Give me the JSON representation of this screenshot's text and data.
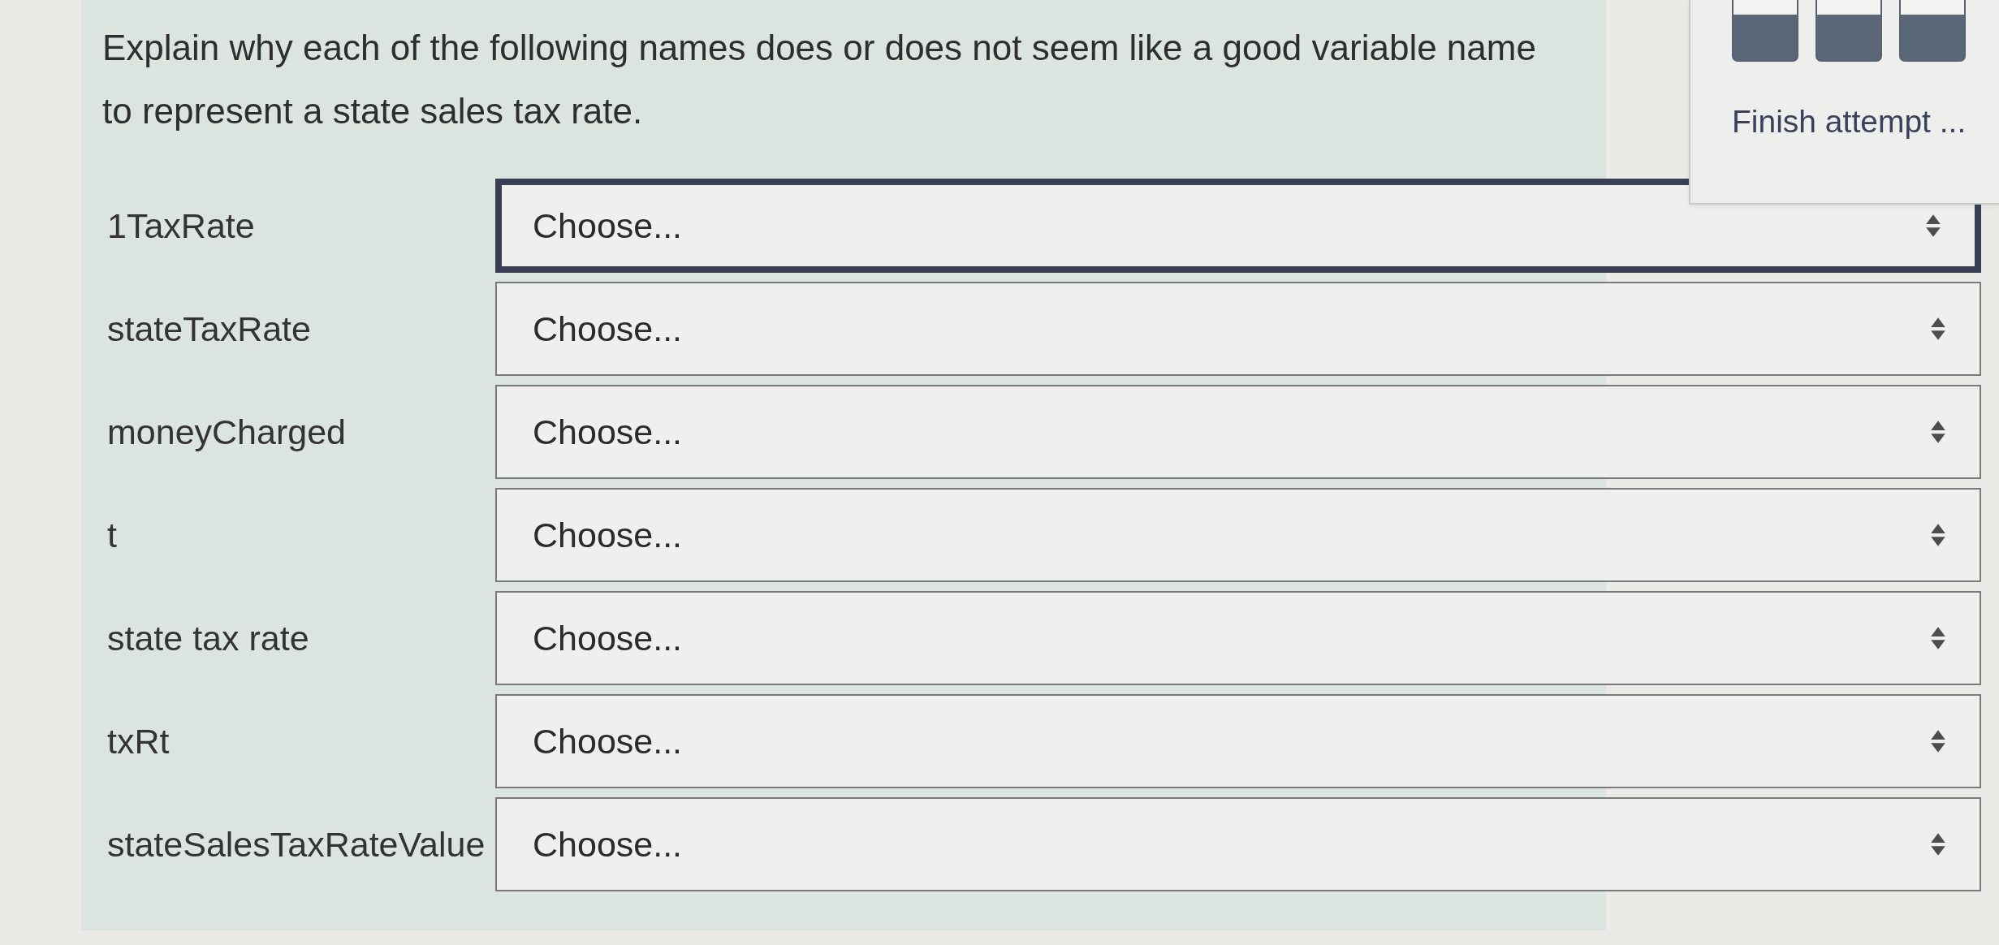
{
  "question": {
    "text": "Explain why each of the following names does or does not seem like a good variable name to represent a state sales tax rate."
  },
  "rows": [
    {
      "label": "1TaxRate",
      "select": {
        "value": "Choose...",
        "focused": true
      }
    },
    {
      "label": "stateTaxRate",
      "select": {
        "value": "Choose...",
        "focused": false
      }
    },
    {
      "label": "moneyCharged",
      "select": {
        "value": "Choose...",
        "focused": false
      }
    },
    {
      "label": "t",
      "select": {
        "value": "Choose...",
        "focused": false
      }
    },
    {
      "label": "state tax rate",
      "select": {
        "value": "Choose...",
        "focused": false
      }
    },
    {
      "label": "txRt",
      "select": {
        "value": "Choose...",
        "focused": false
      }
    },
    {
      "label": "stateSalesTaxRateValue",
      "select": {
        "value": "Choose...",
        "focused": false
      }
    }
  ],
  "quiz_nav": {
    "tiles": [
      {
        "answered": true
      },
      {
        "answered": true
      },
      {
        "answered": true
      }
    ],
    "finish_link": "Finish attempt ..."
  }
}
